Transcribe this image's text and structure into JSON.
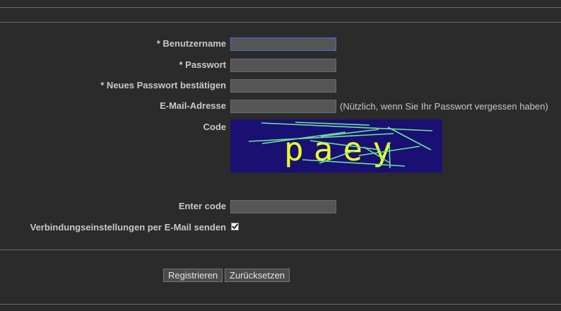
{
  "form": {
    "username": {
      "label": "* Benutzername",
      "value": ""
    },
    "password": {
      "label": "* Passwort",
      "value": ""
    },
    "confirm_password": {
      "label": "* Neues Passwort bestätigen",
      "value": ""
    },
    "email": {
      "label": "E-Mail-Adresse",
      "value": "",
      "hint": "(Nützlich, wenn Sie Ihr Passwort vergessen haben)"
    },
    "captcha": {
      "label": "Code",
      "text": "paey"
    },
    "enter_code": {
      "label": "Enter code",
      "value": ""
    },
    "send_settings": {
      "label": "Verbindungseinstellungen per E-Mail senden",
      "checked": true
    }
  },
  "actions": {
    "register_label": "Registrieren",
    "reset_label": "Zurücksetzen"
  },
  "colors": {
    "background": "#2b2b2b",
    "captcha_background": "#1a0f73",
    "captcha_text": "#e8ff2a",
    "captcha_lines": "#6ee39a",
    "focus_border": "#4a6fd0"
  }
}
